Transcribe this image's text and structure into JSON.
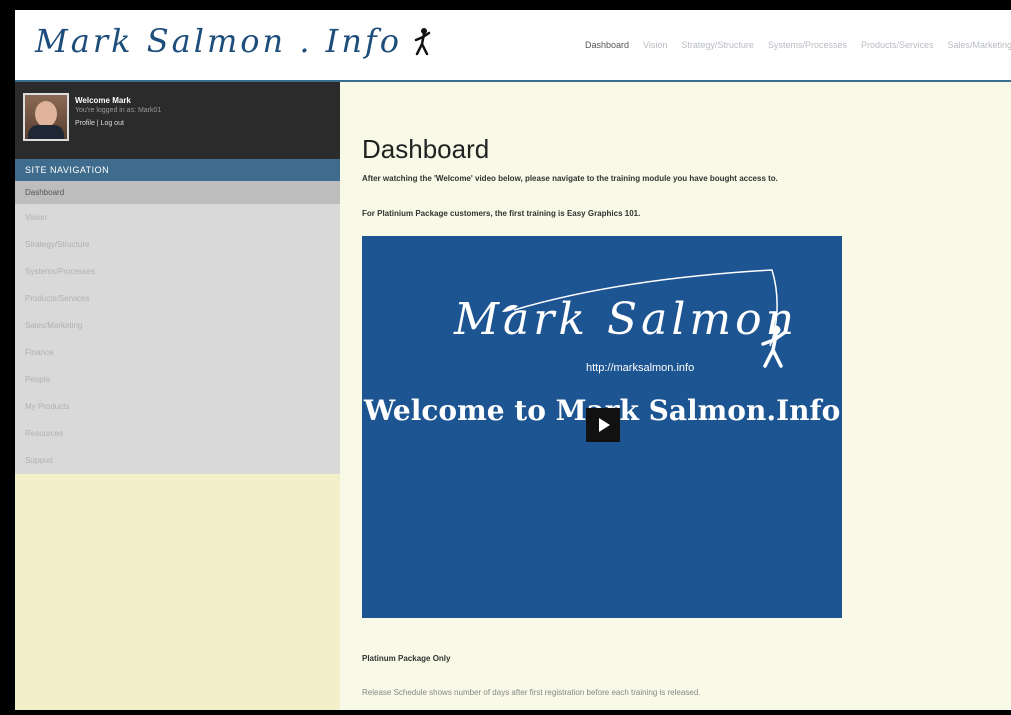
{
  "header": {
    "logo_text": "Mark Salmon . Info",
    "nav": [
      "Dashboard",
      "Vision",
      "Strategy/Structure",
      "Systems/Processes",
      "Products/Services",
      "Sales/Marketing"
    ]
  },
  "user": {
    "welcome": "Welcome Mark",
    "logged_in": "You're logged in as: Mark01",
    "profile_links": "Profile | Log out"
  },
  "sidebar": {
    "heading": "SITE NAVIGATION",
    "items": [
      "Dashboard",
      "Vision",
      "Strategy/Structure",
      "Systems/Processes",
      "Products/Services",
      "Sales/Marketing",
      "Finance",
      "People",
      "My Products",
      "Resources",
      "Support"
    ]
  },
  "main": {
    "title": "Dashboard",
    "intro": "After watching the 'Welcome' video below, please navigate to the training module you have bought access to.",
    "platinum_note": "For Platinium Package customers, the first training is Easy Graphics 101.",
    "video": {
      "logo": "Mark Salmon",
      "url": "http://marksalmon.info",
      "welcome": "Welcome to Mark Salmon.Info"
    },
    "platinum_only": "Platinum Package Only",
    "release_note": "Release Schedule shows number of days after first registration before each training is released."
  },
  "colors": {
    "accent": "#3f6c8c",
    "video_bg": "#1d5492",
    "sidebar_bg": "#f3efc9",
    "main_bg": "#f8f9e6"
  }
}
